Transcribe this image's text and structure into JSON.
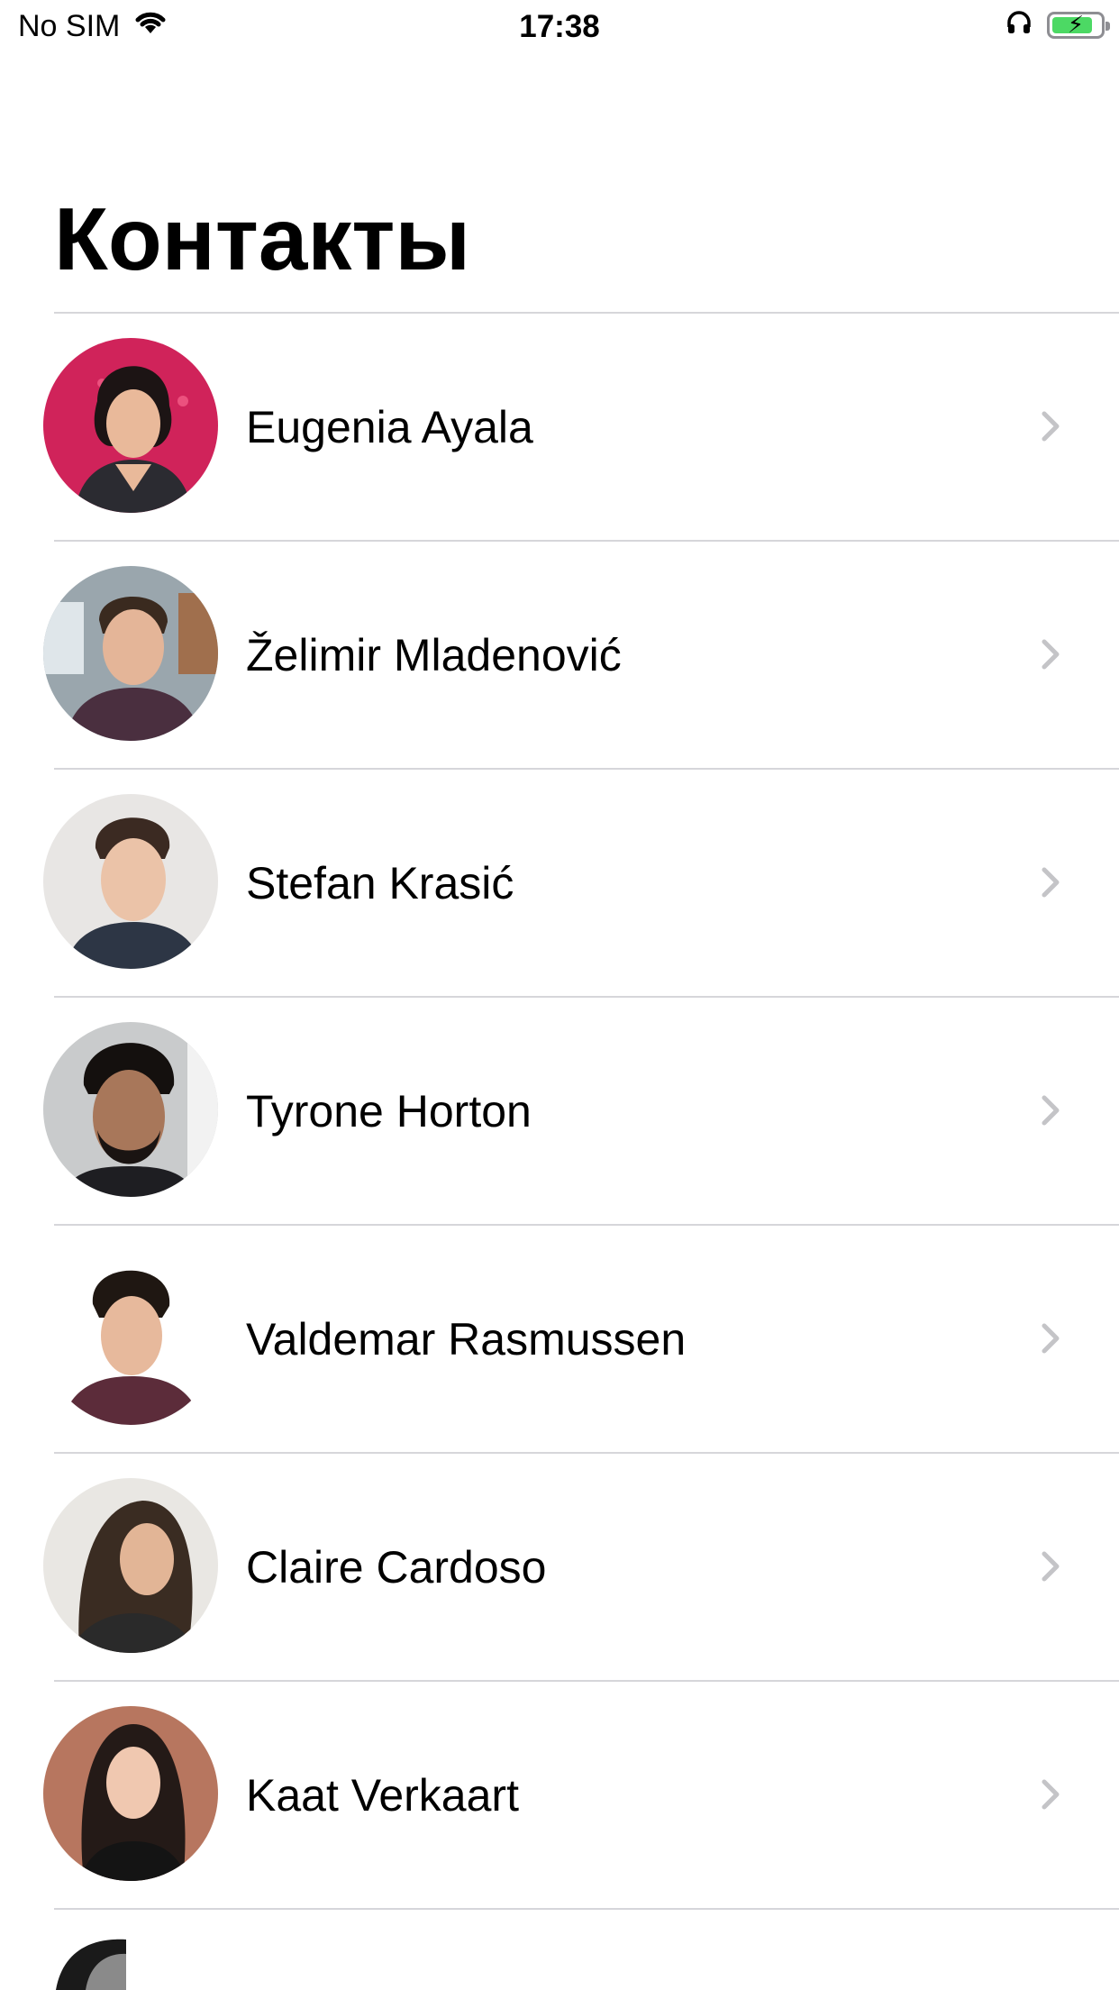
{
  "status_bar": {
    "carrier": "No SIM",
    "time": "17:38",
    "battery_level": 0.85,
    "icons": [
      "wifi-icon",
      "headphones-icon",
      "battery-charging-icon"
    ]
  },
  "page": {
    "title": "Контакты"
  },
  "colors": {
    "separator": "#d6d6da",
    "chevron": "#c4c4c7",
    "battery_fill": "#4cd964"
  },
  "contacts": [
    {
      "name": "Eugenia Ayala",
      "avatar_bg": "#d0235a"
    },
    {
      "name": "Želimir Mladenović",
      "avatar_bg": "#9aa6ad"
    },
    {
      "name": "Stefan Krasić",
      "avatar_bg": "#e8e6e4"
    },
    {
      "name": "Tyrone Horton",
      "avatar_bg": "#c9cbcc"
    },
    {
      "name": "Valdemar Rasmussen",
      "avatar_bg": "#ffffff"
    },
    {
      "name": "Claire Cardoso",
      "avatar_bg": "#e9e7e3"
    },
    {
      "name": "Kaat Verkaart",
      "avatar_bg": "#b7765f"
    }
  ]
}
